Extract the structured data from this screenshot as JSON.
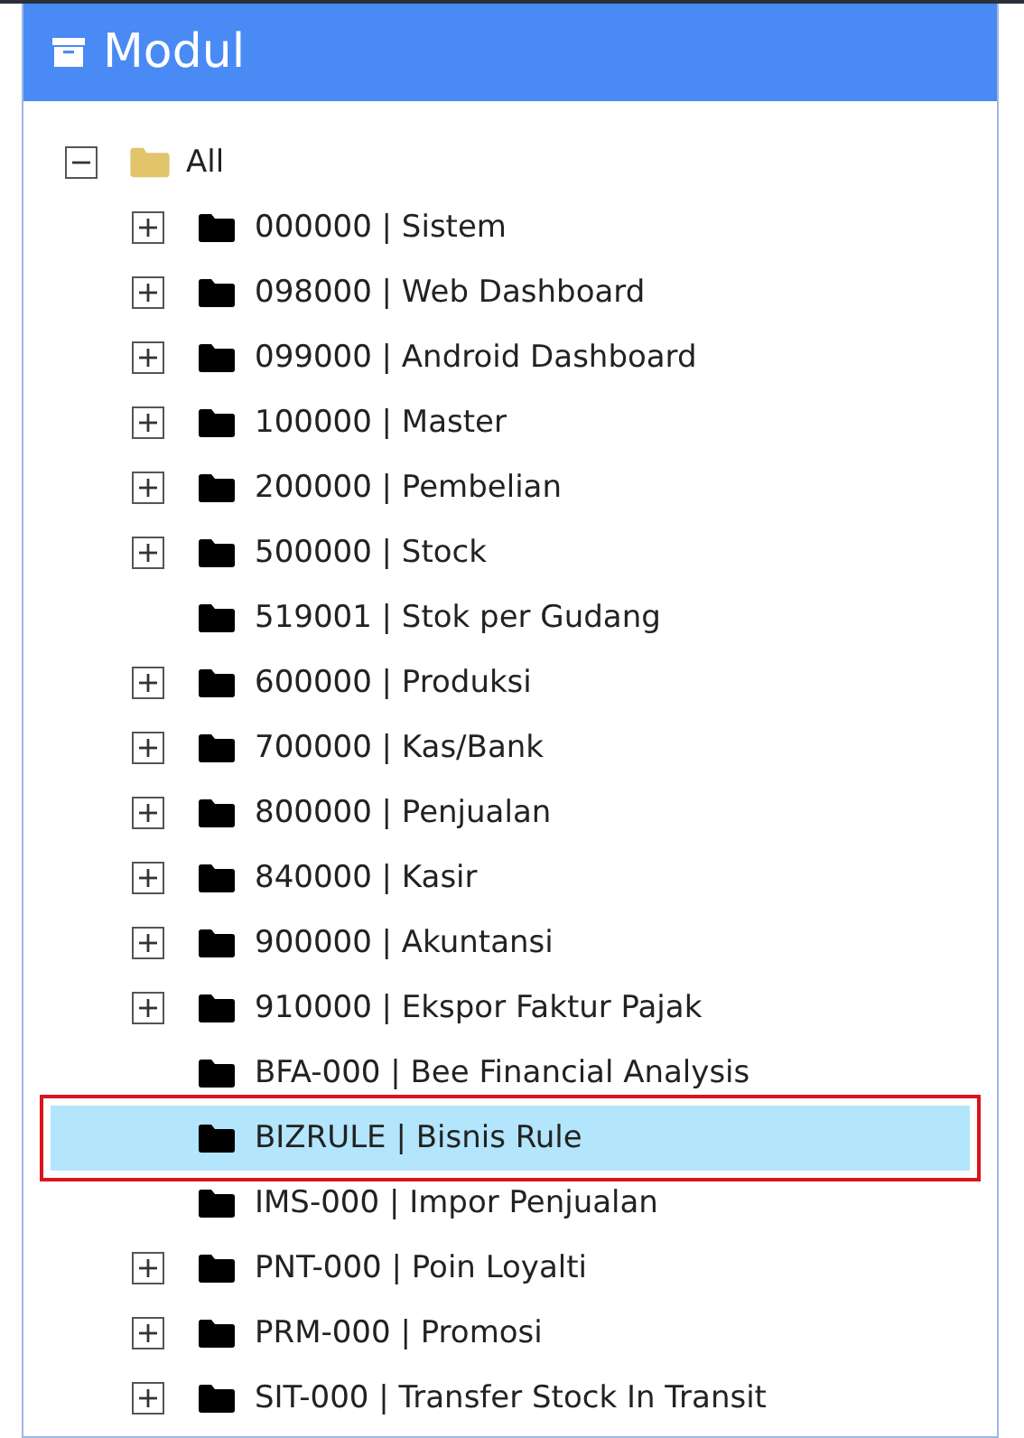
{
  "panel": {
    "title": "Modul"
  },
  "tree": {
    "label": "All",
    "expanded": true,
    "selected": false,
    "children": [
      {
        "label": "000000 | Sistem",
        "kind": "branch",
        "selected": false
      },
      {
        "label": "098000 | Web Dashboard",
        "kind": "branch",
        "selected": false
      },
      {
        "label": "099000 | Android Dashboard",
        "kind": "branch",
        "selected": false
      },
      {
        "label": "100000 | Master",
        "kind": "branch",
        "selected": false
      },
      {
        "label": "200000 | Pembelian",
        "kind": "branch",
        "selected": false
      },
      {
        "label": "500000 | Stock",
        "kind": "branch",
        "selected": false
      },
      {
        "label": "519001 | Stok per Gudang",
        "kind": "leaf",
        "selected": false
      },
      {
        "label": "600000 | Produksi",
        "kind": "branch",
        "selected": false
      },
      {
        "label": "700000 | Kas/Bank",
        "kind": "branch",
        "selected": false
      },
      {
        "label": "800000 | Penjualan",
        "kind": "branch",
        "selected": false
      },
      {
        "label": "840000 | Kasir",
        "kind": "branch",
        "selected": false
      },
      {
        "label": "900000 | Akuntansi",
        "kind": "branch",
        "selected": false
      },
      {
        "label": "910000 | Ekspor Faktur Pajak",
        "kind": "branch",
        "selected": false
      },
      {
        "label": "BFA-000 | Bee Financial Analysis",
        "kind": "leaf",
        "selected": false
      },
      {
        "label": "BIZRULE | Bisnis Rule",
        "kind": "leaf",
        "selected": true
      },
      {
        "label": "IMS-000 | Impor Penjualan",
        "kind": "leaf",
        "selected": false
      },
      {
        "label": "PNT-000 | Poin Loyalti",
        "kind": "branch",
        "selected": false
      },
      {
        "label": "PRM-000 | Promosi",
        "kind": "branch",
        "selected": false
      },
      {
        "label": "SIT-000 | Transfer Stock In Transit",
        "kind": "branch",
        "selected": false
      }
    ]
  }
}
